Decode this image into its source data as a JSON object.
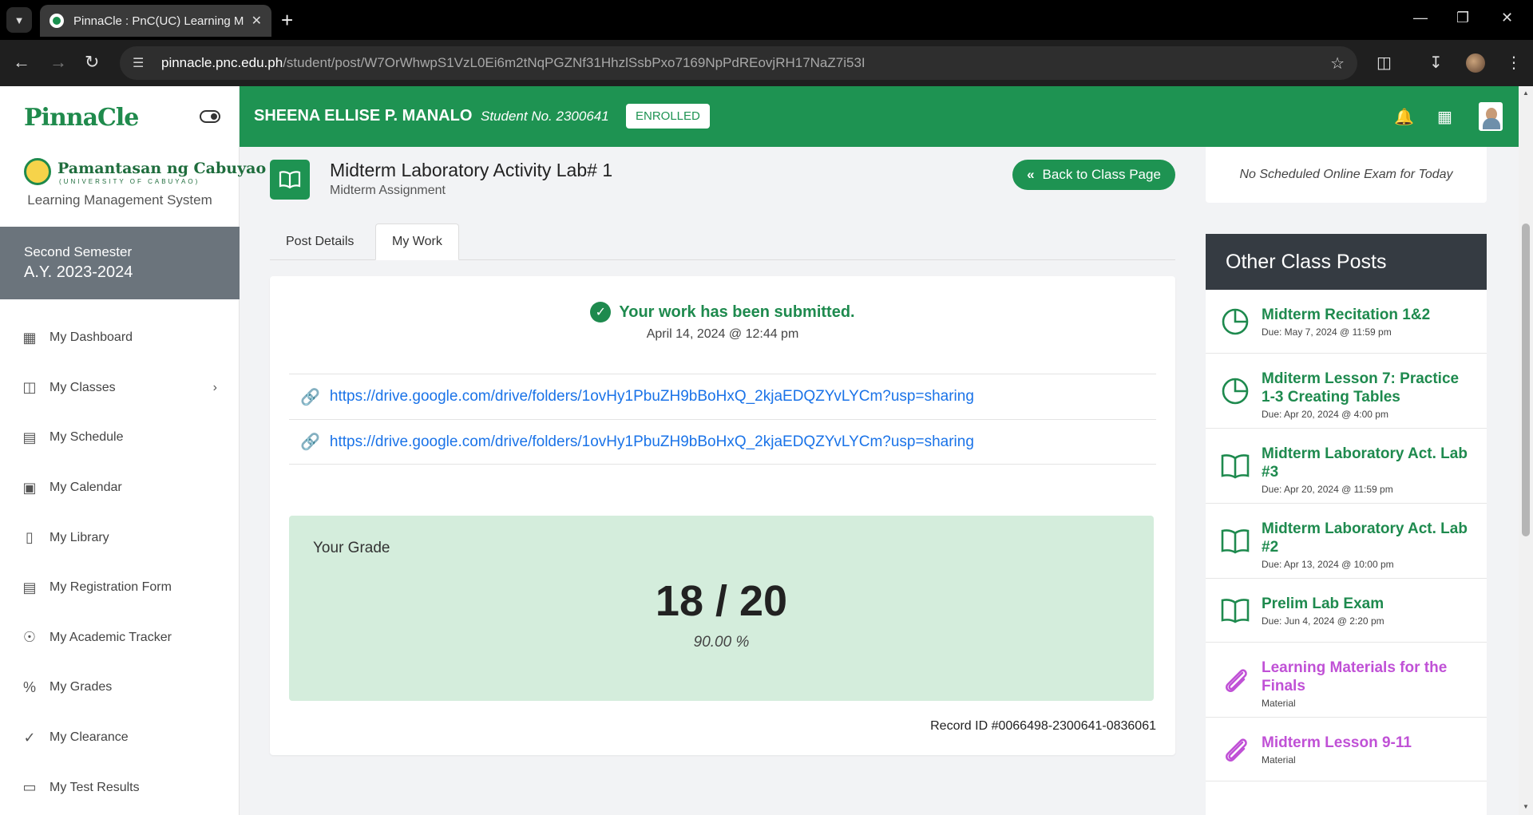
{
  "browser": {
    "tab_title": "PinnaCle : PnC(UC) Learning Ma",
    "url_host": "pinnacle.pnc.edu.ph",
    "url_path": "/student/post/W7OrWhwpS1VzL0Ei6m2tNqPGZNf31HhzlSsbPxo7169NpPdREovjRH17NaZ7i53I"
  },
  "sidebar": {
    "logo": "PinnaCle",
    "university_name": "Pamantasan ng Cabuyao",
    "university_sub": "(UNIVERSITY OF CABUYAO)",
    "system_name": "Learning Management System",
    "semester": "Second Semester",
    "academic_year": "A.Y. 2023-2024",
    "items": [
      {
        "label": "My Dashboard"
      },
      {
        "label": "My Classes"
      },
      {
        "label": "My Schedule"
      },
      {
        "label": "My Calendar"
      },
      {
        "label": "My Library"
      },
      {
        "label": "My Registration Form"
      },
      {
        "label": "My Academic Tracker"
      },
      {
        "label": "My Grades"
      },
      {
        "label": "My Clearance"
      },
      {
        "label": "My Test Results"
      }
    ]
  },
  "header": {
    "student_name": "SHEENA ELLISE P. MANALO",
    "student_no": "Student No. 2300641",
    "status": "ENROLLED"
  },
  "post": {
    "title": "Midterm Laboratory Activity Lab# 1",
    "subtitle": "Midterm Assignment",
    "back_label": "Back to Class Page",
    "tabs": [
      {
        "label": "Post Details"
      },
      {
        "label": "My Work"
      }
    ],
    "active_tab": "My Work",
    "submitted_msg": "Your work has been submitted.",
    "submitted_date": "April 14, 2024 @ 12:44 pm",
    "links": [
      {
        "url": "https://drive.google.com/drive/folders/1ovHy1PbuZH9bBoHxQ_2kjaEDQZYvLYCm?usp=sharing"
      },
      {
        "url": "https://drive.google.com/drive/folders/1ovHy1PbuZH9bBoHxQ_2kjaEDQZYvLYCm?usp=sharing"
      }
    ],
    "grade_label": "Your Grade",
    "grade_value": "18 / 20",
    "grade_percent": "90.00 %",
    "record_id": "Record ID #0066498-2300641-0836061"
  },
  "right": {
    "no_exam": "No Scheduled Online Exam for Today",
    "other_posts_title": "Other Class Posts",
    "other_posts": [
      {
        "title": "Midterm Recitation 1&2",
        "detail": "Due: May 7, 2024 @ 11:59 pm",
        "icon": "pie-chart-icon"
      },
      {
        "title": "Mditerm Lesson 7: Practice 1-3 Creating Tables",
        "detail": "Due: Apr 20, 2024 @ 4:00 pm",
        "icon": "pie-chart-icon"
      },
      {
        "title": "Midterm Laboratory Act. Lab #3",
        "detail": "Due: Apr 20, 2024 @ 11:59 pm",
        "icon": "book-icon"
      },
      {
        "title": "Midterm Laboratory Act. Lab #2",
        "detail": "Due: Apr 13, 2024 @ 10:00 pm",
        "icon": "book-icon"
      },
      {
        "title": "Prelim Lab Exam",
        "detail": "Due: Jun 4, 2024 @ 2:20 pm",
        "icon": "book-icon"
      },
      {
        "title": "Learning Materials for the Finals",
        "detail": "Material",
        "icon": "paperclip-icon"
      },
      {
        "title": "Midterm Lesson 9-11",
        "detail": "Material",
        "icon": "paperclip-icon"
      }
    ]
  },
  "colors": {
    "brand_green": "#1e9352",
    "material_purple": "#c051d6",
    "link_blue": "#1a73e8",
    "grade_bg": "#d4eddc"
  }
}
